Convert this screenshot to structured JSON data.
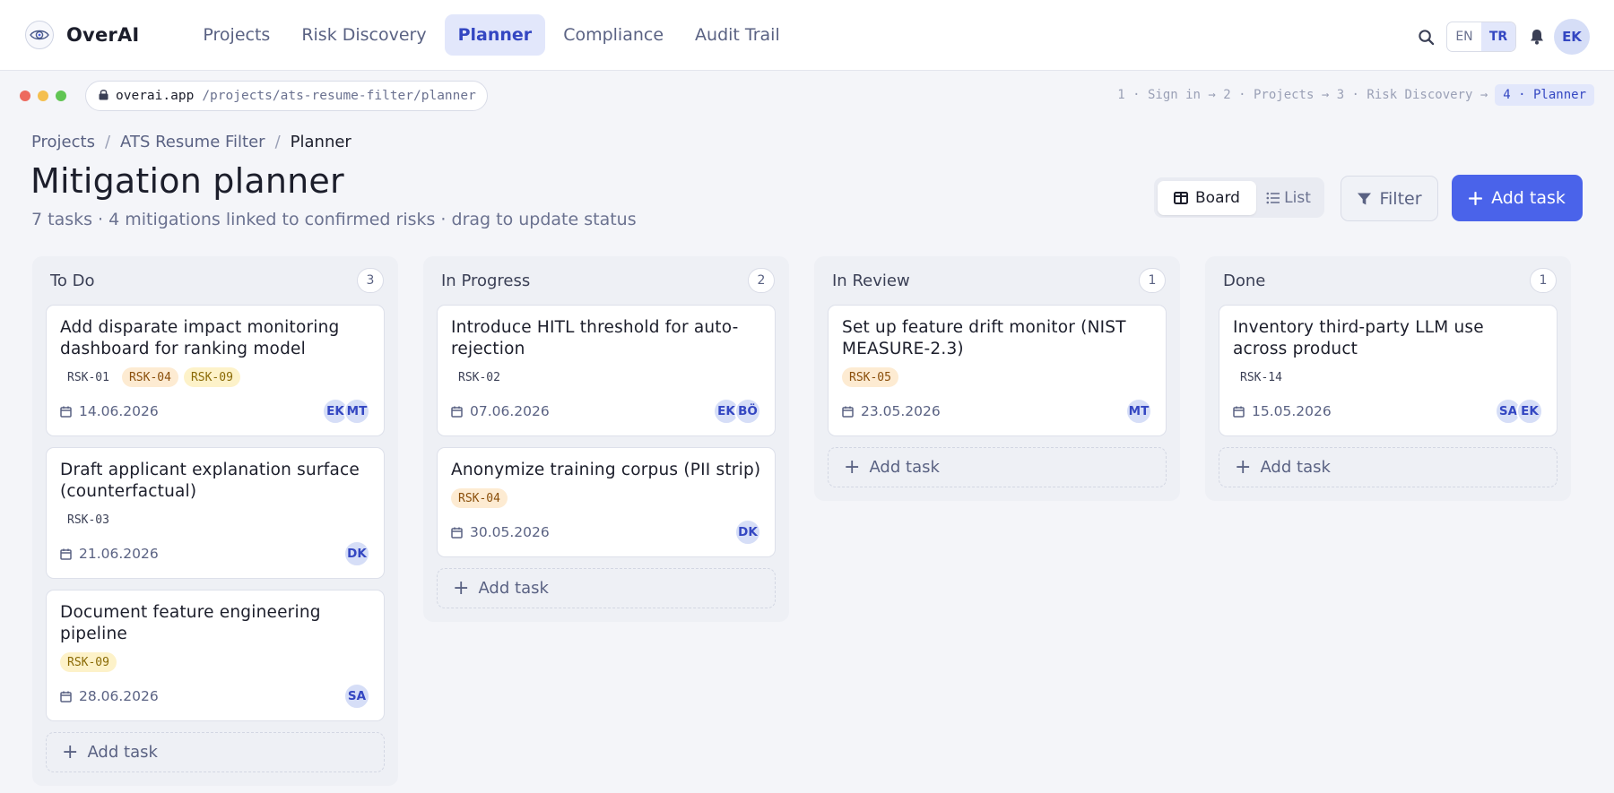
{
  "app": {
    "name": "OverAI",
    "nav": [
      {
        "label": "Projects",
        "active": false
      },
      {
        "label": "Risk Discovery",
        "active": false
      },
      {
        "label": "Planner",
        "active": true
      },
      {
        "label": "Compliance",
        "active": false
      },
      {
        "label": "Audit Trail",
        "active": false
      }
    ],
    "lang": {
      "options": [
        "EN",
        "TR"
      ],
      "selected": "TR"
    },
    "user_initials": "EK",
    "accent_color": "#4a63ea"
  },
  "browser": {
    "url_host": "overai.app",
    "url_path": "/projects/ats-resume-filter/planner",
    "steps_prefix": "1 · Sign in → 2 · Projects → 3 · Risk Discovery →",
    "step_current": "4 · Planner"
  },
  "breadcrumb": [
    "Projects",
    "ATS Resume Filter",
    "Planner"
  ],
  "page": {
    "title": "Mitigation planner",
    "subtitle": "7 tasks · 4 mitigations linked to confirmed risks · drag to update status"
  },
  "toolbar": {
    "view_board": "Board",
    "view_list": "List",
    "selected_view": "Board",
    "filter_label": "Filter",
    "add_task_label": "Add task"
  },
  "columns": [
    {
      "title": "To Do",
      "count": "3",
      "add_label": "Add task",
      "cards": [
        {
          "title": "Add disparate impact monitoring dashboard for ranking model",
          "tags": [
            {
              "id": "RSK-01",
              "tone": "plain"
            },
            {
              "id": "RSK-04",
              "tone": "amber"
            },
            {
              "id": "RSK-09",
              "tone": "yellow"
            }
          ],
          "due": "14.06.2026",
          "assignees": [
            "EK",
            "MT"
          ]
        },
        {
          "title": "Draft applicant explanation surface (counterfactual)",
          "tags": [
            {
              "id": "RSK-03",
              "tone": "plain"
            }
          ],
          "due": "21.06.2026",
          "assignees": [
            "DK"
          ]
        },
        {
          "title": "Document feature engineering pipeline",
          "tags": [
            {
              "id": "RSK-09",
              "tone": "yellow"
            }
          ],
          "due": "28.06.2026",
          "assignees": [
            "SA"
          ]
        }
      ]
    },
    {
      "title": "In Progress",
      "count": "2",
      "add_label": "Add task",
      "cards": [
        {
          "title": "Introduce HITL threshold for auto-rejection",
          "tags": [
            {
              "id": "RSK-02",
              "tone": "plain"
            }
          ],
          "due": "07.06.2026",
          "assignees": [
            "EK",
            "BÖ"
          ]
        },
        {
          "title": "Anonymize training corpus (PII strip)",
          "tags": [
            {
              "id": "RSK-04",
              "tone": "amber"
            }
          ],
          "due": "30.05.2026",
          "assignees": [
            "DK"
          ]
        }
      ]
    },
    {
      "title": "In Review",
      "count": "1",
      "add_label": "Add task",
      "cards": [
        {
          "title": "Set up feature drift monitor (NIST MEASURE-2.3)",
          "tags": [
            {
              "id": "RSK-05",
              "tone": "amber"
            }
          ],
          "due": "23.05.2026",
          "assignees": [
            "MT"
          ]
        }
      ]
    },
    {
      "title": "Done",
      "count": "1",
      "add_label": "Add task",
      "cards": [
        {
          "title": "Inventory third-party LLM use across product",
          "tags": [
            {
              "id": "RSK-14",
              "tone": "plain"
            }
          ],
          "due": "15.05.2026",
          "assignees": [
            "SA",
            "EK"
          ]
        }
      ]
    }
  ]
}
